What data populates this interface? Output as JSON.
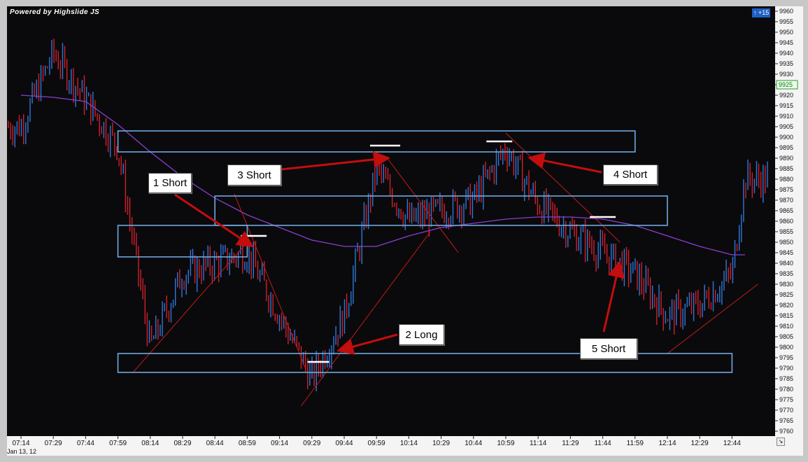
{
  "header": {
    "powered_by": "Powered by Highslide JS",
    "corner_tag": "↑ +15"
  },
  "colors": {
    "background": "#0a0a0c",
    "up_bar": "#2f77d8",
    "down_bar": "#d0202a",
    "moving_average": "#8a3fd1",
    "zone_box": "#6fa8e0",
    "arrow": "#c40d0d",
    "trendline": "#c41a1a",
    "level_marker": "#ffffff",
    "price_tag": "#1a6e1a"
  },
  "axes": {
    "y_ticks": [
      "9960",
      "9955",
      "9950",
      "9945",
      "9940",
      "9935",
      "9930",
      "9925",
      "9920",
      "9915",
      "9910",
      "9905",
      "9900",
      "9895",
      "9890",
      "9885",
      "9880",
      "9875",
      "9870",
      "9865",
      "9860",
      "9855",
      "9850",
      "9845",
      "9840",
      "9835",
      "9830",
      "9825",
      "9820",
      "9815",
      "9810",
      "9805",
      "9800",
      "9795",
      "9790",
      "9785",
      "9780",
      "9775",
      "9770",
      "9765",
      "9760"
    ],
    "x_ticks": [
      "07:14",
      "07:29",
      "07:44",
      "07:59",
      "08:14",
      "08:29",
      "08:44",
      "08:59",
      "09:14",
      "09:29",
      "09:44",
      "09:59",
      "10:14",
      "10:29",
      "10:44",
      "10:59",
      "11:14",
      "11:29",
      "11:44",
      "11:59",
      "12:14",
      "12:29",
      "12:44"
    ],
    "date_label": "Jan 13, 12",
    "current_price": "9925"
  },
  "annotations": [
    {
      "id": "1",
      "label": "1 Short"
    },
    {
      "id": "2",
      "label": "2 Long"
    },
    {
      "id": "3",
      "label": "3 Short"
    },
    {
      "id": "4",
      "label": "4 Short"
    },
    {
      "id": "5",
      "label": "5 Short"
    }
  ],
  "chart_data": {
    "type": "line",
    "title": "",
    "xlabel": "",
    "ylabel": "",
    "ylim": [
      9760,
      9960
    ],
    "x_range": [
      "07:14",
      "12:44"
    ],
    "grid": false,
    "series": [
      {
        "x": [
          "07:14",
          "07:29",
          "07:44",
          "07:59",
          "08:14",
          "08:29",
          "08:44",
          "08:59",
          "09:14",
          "09:29",
          "09:44",
          "09:59",
          "10:14",
          "10:29",
          "10:44",
          "10:59",
          "11:14",
          "11:29",
          "11:44",
          "11:59",
          "12:14",
          "12:29",
          "12:44",
          "12:50"
        ],
        "values": [
          9905,
          9940,
          9918,
          9895,
          9800,
          9835,
          9840,
          9845,
          9815,
          9785,
          9815,
          9885,
          9860,
          9865,
          9870,
          9895,
          9868,
          9855,
          9845,
          9835,
          9815,
          9820,
          9835,
          9880
        ]
      },
      {
        "x": [
          "07:14",
          "07:29",
          "07:44",
          "07:59",
          "08:14",
          "08:29",
          "08:44",
          "08:59",
          "09:14",
          "09:29",
          "09:44",
          "09:59",
          "10:14",
          "10:29",
          "10:44",
          "10:59",
          "11:14",
          "11:29",
          "11:44",
          "11:59",
          "12:14",
          "12:29",
          "12:44",
          "12:50"
        ],
        "values": [
          9920,
          9919,
          9917,
          9906,
          9893,
          9881,
          9871,
          9863,
          9857,
          9851,
          9848,
          9848,
          9853,
          9857,
          9859,
          9861,
          9862,
          9862,
          9861,
          9858,
          9853,
          9848,
          9844,
          9844
        ]
      }
    ],
    "zones": [
      {
        "from": 9893,
        "to": 9903,
        "x_from": "07:59",
        "x_to": "11:59"
      },
      {
        "from": 9858,
        "to": 9872,
        "x_from": "08:44",
        "x_to": "12:14"
      },
      {
        "from": 9843,
        "to": 9858,
        "x_from": "07:59",
        "x_to": "08:59"
      },
      {
        "from": 9788,
        "to": 9797,
        "x_from": "07:59",
        "x_to": "12:44"
      }
    ]
  }
}
